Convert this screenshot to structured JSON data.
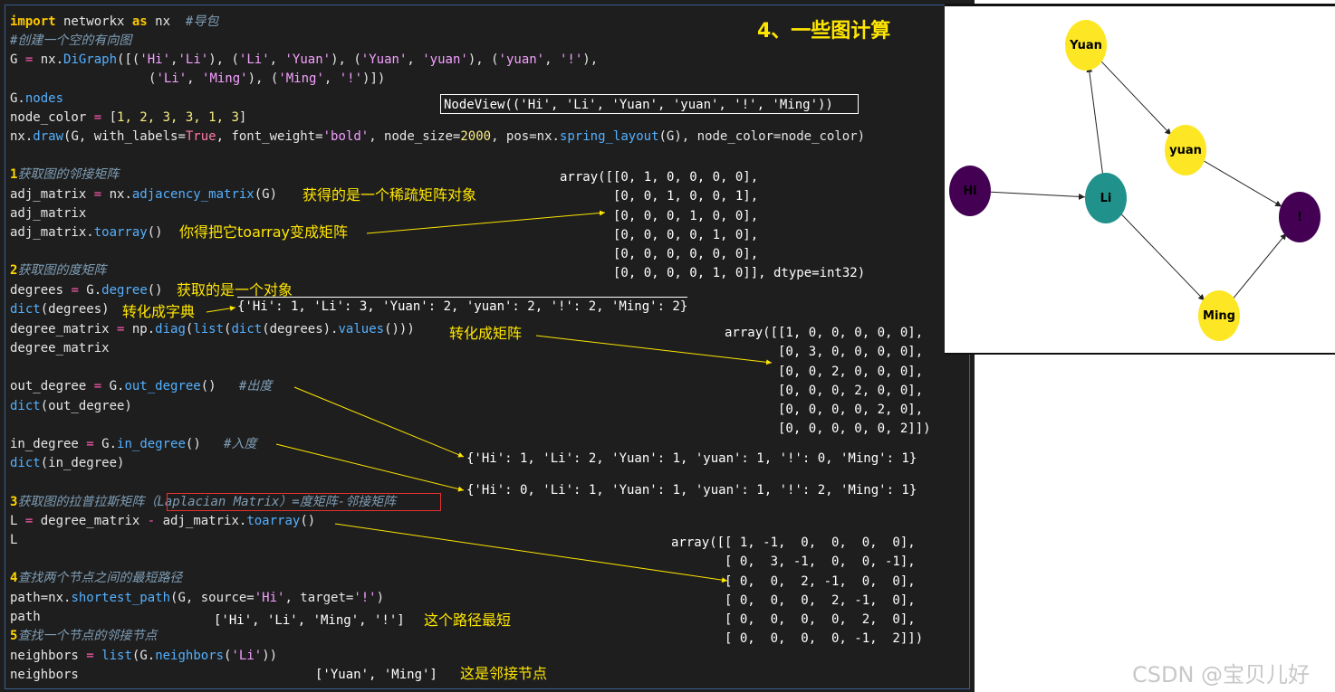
{
  "title": "4、一些图计算",
  "code": {
    "l1_import": "import",
    "l1_nx1": " networkx ",
    "l1_as": "as",
    "l1_nx2": " nx  ",
    "l1_cm": "#导包",
    "l2": "#创建一个空的有向图",
    "l3_a": "G ",
    "l3_eq": "=",
    "l3_b": " nx.",
    "l3_fn": "DiGraph",
    "l3_c": "([(",
    "l3_s1": "'Hi'",
    "l3_s2": "'Li'",
    "l3_s3": "'Li'",
    "l3_s4": "'Yuan'",
    "l3_s5": "'Yuan'",
    "l3_s6": "'yuan'",
    "l3_s7": "'yuan'",
    "l3_s8": "'!'",
    "l4_s1": "'Li'",
    "l4_s2": "'Ming'",
    "l4_s3": "'Ming'",
    "l4_s4": "'!'",
    "l5_a": "G.",
    "l5_fn": "nodes",
    "l6_a": "node_color ",
    "l6_eq": "=",
    "l6_b": " [",
    "l6_n": "1, 2, 3, 3, 1, 3",
    "l6_c": "]",
    "l7_a": "nx.",
    "l7_fn": "draw",
    "l7_b": "(G, with_labels=",
    "l7_true": "True",
    "l7_c": ", font_weight=",
    "l7_s": "'bold'",
    "l7_d": ", node_size=",
    "l7_n": "2000",
    "l7_e": ", pos=nx.",
    "l7_fn2": "spring_layout",
    "l7_f": "(G), node_color=node_color)",
    "s1_num": "1",
    "s1_cm": "获取图的邻接矩阵",
    "l9_a": "adj_matrix ",
    "l9_eq": "=",
    "l9_b": " nx.",
    "l9_fn": "adjacency_matrix",
    "l9_c": "(G)",
    "l10": "adj_matrix",
    "l11_a": "adj_matrix.",
    "l11_fn": "toarray",
    "l11_b": "()",
    "s2_num": "2",
    "s2_cm": "获取图的度矩阵",
    "l13_a": "degrees ",
    "l13_eq": "=",
    "l13_b": " G.",
    "l13_fn": "degree",
    "l13_c": "()",
    "l14_fn": "dict",
    "l14_b": "(degrees)",
    "l15_a": "degree_matrix ",
    "l15_eq": "=",
    "l15_b": " np.",
    "l15_fn": "diag",
    "l15_c": "(",
    "l15_fn2": "list",
    "l15_d": "(",
    "l15_fn3": "dict",
    "l15_e": "(degrees).",
    "l15_fn4": "values",
    "l15_f": "()))",
    "l16": "degree_matrix",
    "l17_a": "out_degree ",
    "l17_eq": "=",
    "l17_b": " G.",
    "l17_fn": "out_degree",
    "l17_c": "()   ",
    "l17_cm": "#出度",
    "l18_fn": "dict",
    "l18_b": "(out_degree)",
    "l19_a": "in_degree ",
    "l19_eq": "=",
    "l19_b": " G.",
    "l19_fn": "in_degree",
    "l19_c": "()   ",
    "l19_cm": "#入度",
    "l20_fn": "dict",
    "l20_b": "(in_degree)",
    "s3_num": "3",
    "s3_cm": "获取图的拉普拉斯矩阵（Laplacian Matrix）=度矩阵-邻接矩阵",
    "l22_a": "L ",
    "l22_eq": "=",
    "l22_b": " degree_matrix ",
    "l22_minus": "-",
    "l22_c": " adj_matrix.",
    "l22_fn": "toarray",
    "l22_d": "()",
    "l23": "L",
    "s4_num": "4",
    "s4_cm": "查找两个节点之间的最短路径",
    "l25_a": "path=nx.",
    "l25_fn": "shortest_path",
    "l25_b": "(G, source=",
    "l25_s1": "'Hi'",
    "l25_c": ", target=",
    "l25_s2": "'!'",
    "l25_d": ")",
    "l26": "path",
    "s5_num": "5",
    "s5_cm": "查找一个节点的邻接节点",
    "l28_a": "neighbors ",
    "l28_eq": "=",
    "l28_b": " ",
    "l28_fn": "list",
    "l28_c": "(G.",
    "l28_fn2": "neighbors",
    "l28_d": "(",
    "l28_s": "'Li'",
    "l28_e": "))",
    "l29": "neighbors"
  },
  "outputs": {
    "nodeview": "NodeView(('Hi', 'Li', 'Yuan', 'yuan', '!', 'Ming'))",
    "adj_array": "array([[0, 1, 0, 0, 0, 0],\n       [0, 0, 1, 0, 0, 1],\n       [0, 0, 0, 1, 0, 0],\n       [0, 0, 0, 0, 1, 0],\n       [0, 0, 0, 0, 0, 0],\n       [0, 0, 0, 0, 1, 0]], dtype=int32)",
    "degree_dict": "{'Hi': 1, 'Li': 3, 'Yuan': 2, 'yuan': 2, '!': 2, 'Ming': 2}",
    "degree_array": "array([[1, 0, 0, 0, 0, 0],\n       [0, 3, 0, 0, 0, 0],\n       [0, 0, 2, 0, 0, 0],\n       [0, 0, 0, 2, 0, 0],\n       [0, 0, 0, 0, 2, 0],\n       [0, 0, 0, 0, 0, 2]])",
    "out_degree_dict": "{'Hi': 1, 'Li': 2, 'Yuan': 1, 'yuan': 1, '!': 0, 'Ming': 1}",
    "in_degree_dict": "{'Hi': 0, 'Li': 1, 'Yuan': 1, 'yuan': 1, '!': 2, 'Ming': 1}",
    "laplacian_array": "array([[ 1, -1,  0,  0,  0,  0],\n       [ 0,  3, -1,  0,  0, -1],\n       [ 0,  0,  2, -1,  0,  0],\n       [ 0,  0,  0,  2, -1,  0],\n       [ 0,  0,  0,  0,  2,  0],\n       [ 0,  0,  0,  0, -1,  2]])",
    "path_list": "['Hi', 'Li', 'Ming', '!']",
    "neighbors_list": "['Yuan', 'Ming']"
  },
  "notes": {
    "sparse": "获得的是一个稀疏矩阵对象",
    "toarray": "你得把它toarray变成矩阵",
    "object": "获取的是一个对象",
    "to_dict": "转化成字典",
    "to_matrix": "转化成矩阵",
    "shortest": "这个路径最短",
    "neighbors": "这是邻接节点"
  },
  "graph": {
    "nodes": [
      {
        "id": "Hi",
        "color": "#440154"
      },
      {
        "id": "Li",
        "color": "#21918c"
      },
      {
        "id": "Yuan",
        "color": "#fde725"
      },
      {
        "id": "yuan",
        "color": "#fde725"
      },
      {
        "id": "!",
        "color": "#440154"
      },
      {
        "id": "Ming",
        "color": "#fde725"
      }
    ],
    "edges": [
      [
        "Hi",
        "Li"
      ],
      [
        "Li",
        "Yuan"
      ],
      [
        "Yuan",
        "yuan"
      ],
      [
        "yuan",
        "!"
      ],
      [
        "Li",
        "Ming"
      ],
      [
        "Ming",
        "!"
      ]
    ]
  },
  "colors": {
    "editor_bg": "#1e1e1e",
    "annotation": "#ffe600",
    "keyword": "#ffc800",
    "function": "#54b0ff",
    "string": "#f4a0ff"
  },
  "watermark": "CSDN @宝贝儿好"
}
